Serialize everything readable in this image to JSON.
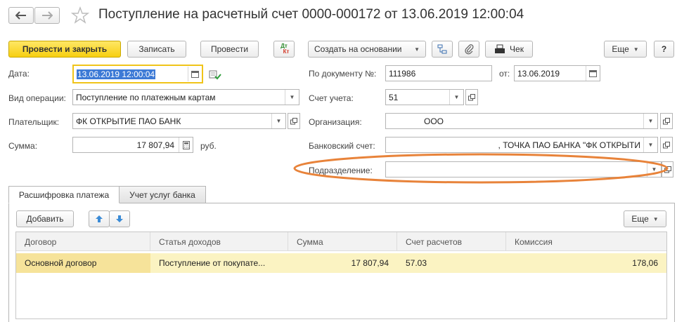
{
  "window": {
    "title": "Поступление на расчетный счет 0000-000172 от 13.06.2019 12:00:04"
  },
  "toolbar": {
    "post_and_close": "Провести и закрыть",
    "save": "Записать",
    "post": "Провести",
    "dt_kt_top": "Дт",
    "dt_kt_bottom": "Кт",
    "create_based_on": "Создать на основании",
    "receipt": "Чек",
    "more": "Еще",
    "help": "?"
  },
  "form": {
    "date_label": "Дата:",
    "date_value": "13.06.2019 12:00:04",
    "doc_number_label": "По документу №:",
    "doc_number_value": "111986",
    "from_label": "от:",
    "from_value": "13.06.2019",
    "operation_label": "Вид операции:",
    "operation_value": "Поступление по платежным картам",
    "account_label": "Счет учета:",
    "account_value": "51",
    "payer_label": "Плательщик:",
    "payer_value": "ФК ОТКРЫТИЕ ПАО БАНК",
    "org_label": "Организация:",
    "org_value": "ООО",
    "amount_label": "Сумма:",
    "amount_value": "17 807,94",
    "currency": "руб.",
    "bank_account_label": "Банковский счет:",
    "bank_account_value": ", ТОЧКА ПАО БАНКА \"ФК ОТКРЫТИ",
    "division_label": "Подразделение:",
    "division_value": ""
  },
  "tabs": [
    {
      "label": "Расшифровка платежа",
      "active": true
    },
    {
      "label": "Учет услуг банка",
      "active": false
    }
  ],
  "table_toolbar": {
    "add": "Добавить",
    "more": "Еще"
  },
  "table": {
    "columns": [
      "Договор",
      "Статья доходов",
      "Сумма",
      "Счет расчетов",
      "Комиссия"
    ],
    "rows": [
      [
        "Основной договор",
        "Поступление от покупате...",
        "17 807,94",
        "57.03",
        "178,06"
      ]
    ]
  },
  "colors": {
    "primary_button": "#f7cf11",
    "highlight_ellipse": "#e8833a",
    "selected_row": "#fbf3c2",
    "date_selection": "#3d7ad6"
  }
}
